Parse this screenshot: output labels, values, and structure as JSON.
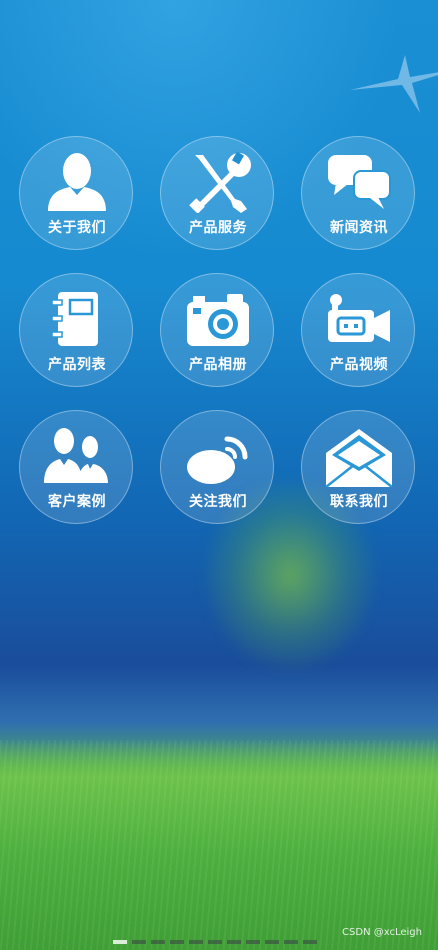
{
  "background": {
    "sky_color": "#1b8fd3",
    "grass_color": "#4caf3e"
  },
  "menu": {
    "items": [
      {
        "label": "关于我们",
        "icon": "person-icon"
      },
      {
        "label": "产品服务",
        "icon": "tools-icon"
      },
      {
        "label": "新闻资讯",
        "icon": "chat-bubbles-icon"
      },
      {
        "label": "产品列表",
        "icon": "notebook-icon"
      },
      {
        "label": "产品相册",
        "icon": "camera-icon"
      },
      {
        "label": "产品视频",
        "icon": "video-camera-icon"
      },
      {
        "label": "客户案例",
        "icon": "group-icon"
      },
      {
        "label": "关注我们",
        "icon": "weibo-icon"
      },
      {
        "label": "联系我们",
        "icon": "envelope-icon"
      }
    ]
  },
  "footer": {
    "watermark": "CSDN @xcLeigh"
  },
  "pager": {
    "count": 11,
    "active_index": 0
  }
}
